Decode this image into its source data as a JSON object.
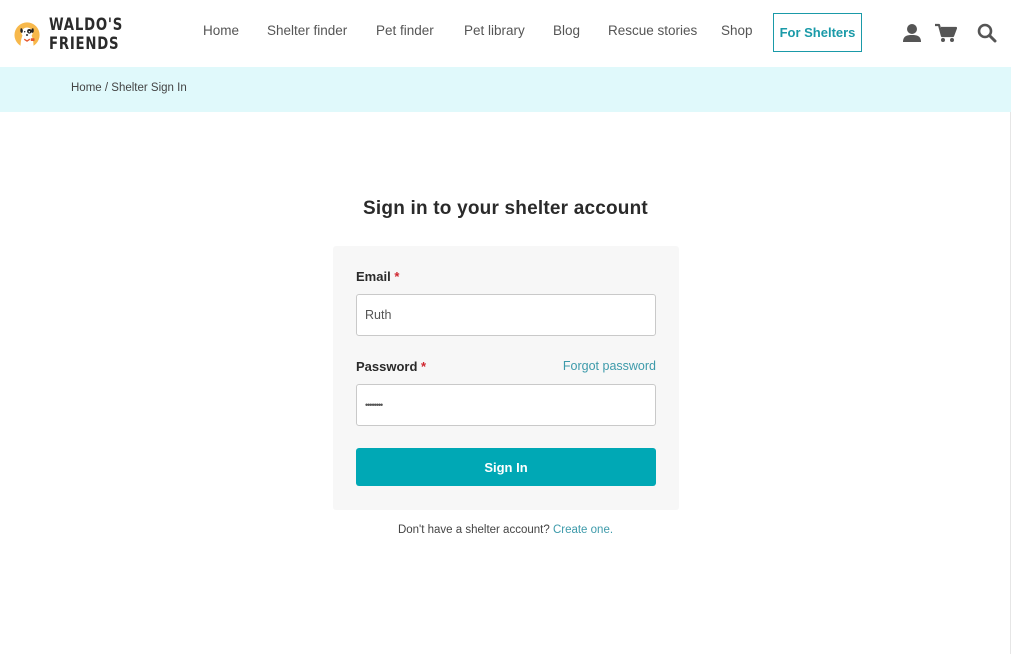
{
  "brand": {
    "name_line1": "WALDO'S",
    "name_line2": "FRIENDS",
    "logo_icon": "dog-logo-icon",
    "accent_color": "#00a8b5",
    "link_color": "#3d9aaa",
    "breadcrumb_bg": "#e0f9fb"
  },
  "nav": {
    "items": [
      {
        "label": "Home"
      },
      {
        "label": "Shelter finder"
      },
      {
        "label": "Pet finder"
      },
      {
        "label": "Pet library"
      },
      {
        "label": "Blog"
      },
      {
        "label": "Rescue stories"
      },
      {
        "label": "Shop"
      }
    ],
    "cta_label": "For Shelters",
    "icons": [
      "user-icon",
      "cart-icon",
      "search-icon"
    ]
  },
  "breadcrumb": {
    "home": "Home",
    "separator": " / ",
    "current": "Shelter Sign In"
  },
  "form": {
    "title": "Sign in to your shelter account",
    "email_label": "Email",
    "email_value": "Ruth",
    "password_label": "Password",
    "password_value": "••••••••",
    "required_marker": "*",
    "forgot_label": "Forgot password",
    "submit_label": "Sign In"
  },
  "footer": {
    "prompt": "Don't have a shelter account? ",
    "create_label": "Create one",
    "trailing": "."
  }
}
